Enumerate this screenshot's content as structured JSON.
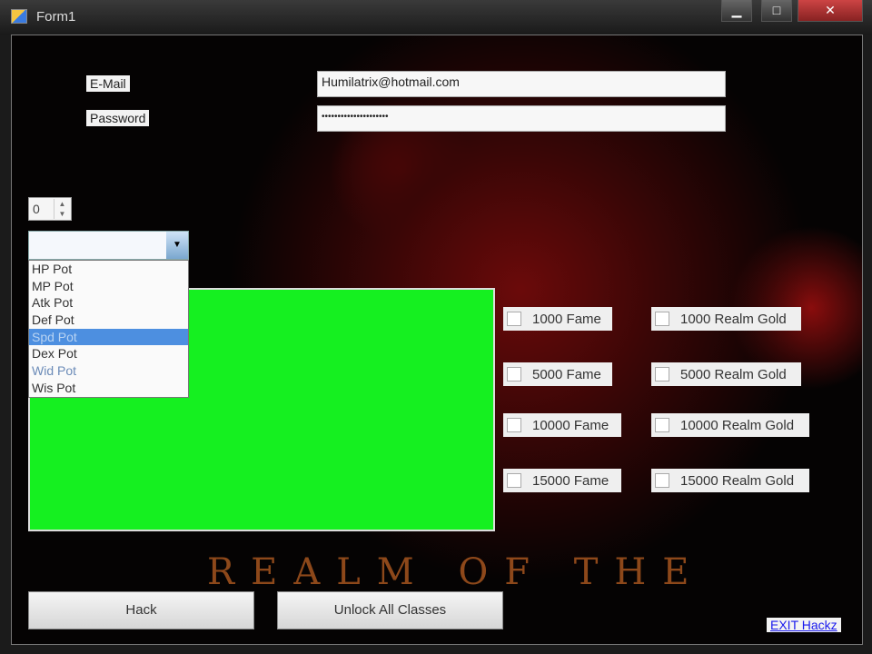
{
  "window": {
    "title": "Form1",
    "minimize": "▁",
    "maximize": "□",
    "close": "✕"
  },
  "form": {
    "email_label": "E-Mail",
    "email_value": "Humilatrix@hotmail.com",
    "password_label": "Password",
    "password_value": "•••••••••••••••••••••",
    "quantity": "0",
    "combo_value": "",
    "combo_options": [
      "HP Pot",
      "MP Pot",
      "Atk Pot",
      "Def Pot",
      "Spd Pot",
      "Dex Pot",
      "Wid Pot",
      "Wis Pot"
    ],
    "selected_option": "Spd Pot"
  },
  "checkboxes": {
    "fame": [
      "1000 Fame",
      "5000 Fame",
      "10000 Fame",
      "15000 Fame"
    ],
    "gold": [
      "1000 Realm Gold",
      "5000 Realm Gold",
      "10000 Realm Gold",
      "15000 Realm Gold"
    ]
  },
  "background_logo": "REALM OF THE",
  "buttons": {
    "hack": "Hack",
    "unlock": "Unlock All Classes",
    "exit": "EXIT Hackz"
  }
}
